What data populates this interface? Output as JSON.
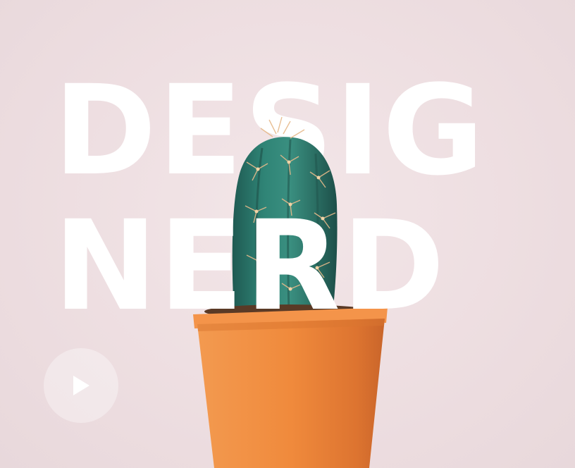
{
  "hero": {
    "line1": "DESIG",
    "line2": "NERD"
  },
  "play_button": {
    "icon": "play-icon"
  },
  "colors": {
    "background": "#f0e1e3",
    "headline": "#ffffff",
    "pot": "#f08a3c",
    "cactus": "#2f7a6a"
  }
}
